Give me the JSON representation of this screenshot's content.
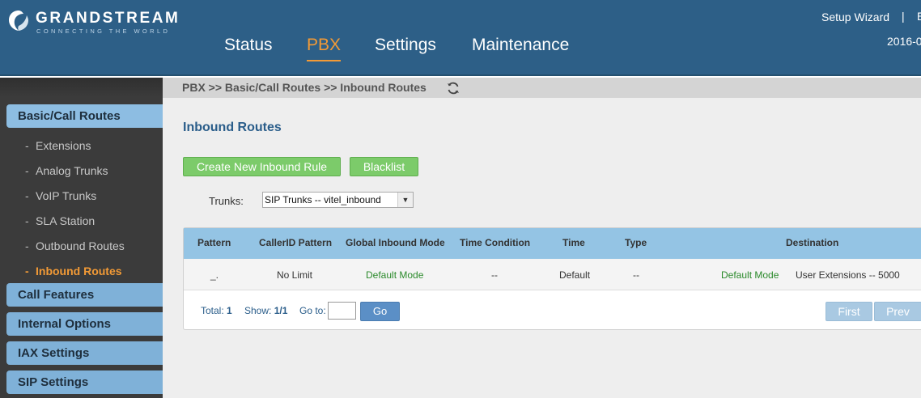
{
  "brand": {
    "name": "GRANDSTREAM",
    "tagline": "CONNECTING THE WORLD"
  },
  "nav": {
    "items": [
      {
        "label": "Status"
      },
      {
        "label": "PBX"
      },
      {
        "label": "Settings"
      },
      {
        "label": "Maintenance"
      }
    ],
    "active": "PBX"
  },
  "topbar": {
    "setup_wizard": "Setup Wizard",
    "separator": "|",
    "extra": "E",
    "date": "2016-0"
  },
  "sidebar": {
    "sections": [
      {
        "label": "Basic/Call Routes"
      },
      {
        "label": "Call Features"
      },
      {
        "label": "Internal Options"
      },
      {
        "label": "IAX Settings"
      },
      {
        "label": "SIP Settings"
      }
    ],
    "items": [
      {
        "label": "Extensions"
      },
      {
        "label": "Analog Trunks"
      },
      {
        "label": "VoIP Trunks"
      },
      {
        "label": "SLA Station"
      },
      {
        "label": "Outbound Routes"
      },
      {
        "label": "Inbound Routes"
      }
    ],
    "active_item": "Inbound Routes"
  },
  "breadcrumb": "PBX >> Basic/Call Routes >> Inbound Routes",
  "page": {
    "title": "Inbound Routes",
    "buttons": {
      "create": "Create New Inbound Rule",
      "blacklist": "Blacklist"
    },
    "trunks": {
      "label": "Trunks:",
      "selected": "SIP Trunks -- vitel_inbound"
    },
    "table": {
      "headers": [
        "Pattern",
        "CallerID Pattern",
        "Global Inbound Mode",
        "Time Condition",
        "Time",
        "Type",
        "Destination"
      ],
      "rows": [
        [
          "_.",
          "No Limit",
          "Default Mode",
          "--",
          "Default",
          "--",
          "Default Mode",
          "User Extensions -- 5000"
        ]
      ]
    },
    "pager": {
      "total_label": "Total:",
      "total": "1",
      "show_label": "Show:",
      "show": "1/1",
      "goto_label": "Go to:",
      "go": "Go",
      "first": "First",
      "prev": "Prev"
    }
  },
  "colors": {
    "header": "#2d5f87",
    "accent": "#f29a36",
    "sidebar": "#3b3b3b",
    "section": "#7fb1d8",
    "green_button": "#7ccb6a",
    "table_header": "#94c4e4"
  },
  "icons": {
    "logo": "grandstream-logo-icon",
    "refresh": "refresh-icon",
    "dropdown": "dropdown-arrow-icon"
  }
}
